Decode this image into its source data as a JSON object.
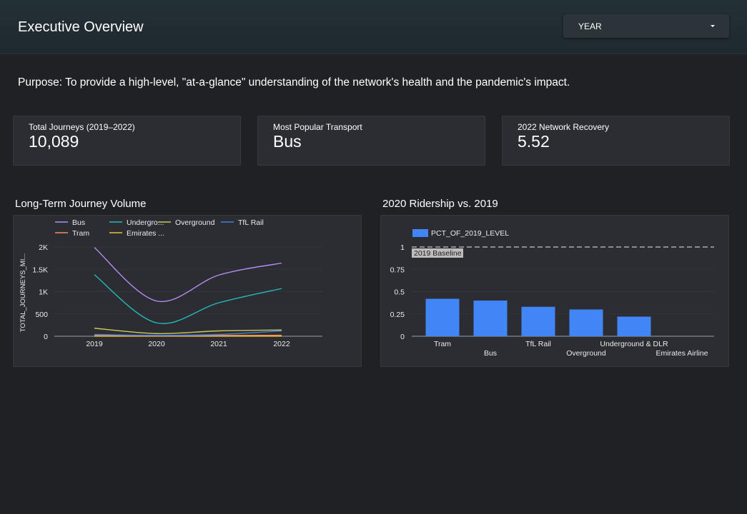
{
  "header": {
    "title": "Executive Overview",
    "year_filter_label": "YEAR"
  },
  "purpose": "Purpose: To provide a high-level, \"at-a-glance\" understanding of the network's health and the pandemic's impact.",
  "kpis": [
    {
      "label": "Total Journeys (2019–2022)",
      "value": "10,089"
    },
    {
      "label": "Most Popular Transport",
      "value": "Bus"
    },
    {
      "label": "2022 Network Recovery",
      "value": "5.52"
    }
  ],
  "charts": {
    "line_title": "Long-Term Journey Volume",
    "bar_title": "2020 Ridership vs. 2019"
  },
  "chart_data": [
    {
      "type": "line",
      "title": "Long-Term Journey Volume",
      "xlabel": "",
      "ylabel": "TOTAL_JOURNEYS_MI...",
      "x": [
        "2019",
        "2020",
        "2021",
        "2022"
      ],
      "ylim": [
        0,
        2000
      ],
      "yticks": [
        {
          "value": 0,
          "label": "0"
        },
        {
          "value": 500,
          "label": "500"
        },
        {
          "value": 1000,
          "label": "1K"
        },
        {
          "value": 1500,
          "label": "1.5K"
        },
        {
          "value": 2000,
          "label": "2K"
        }
      ],
      "legend_position": "top",
      "series": [
        {
          "name": "Bus",
          "legend_label": "Bus",
          "color": "#b48cf2",
          "values": [
            1990,
            790,
            1370,
            1640
          ]
        },
        {
          "name": "Underground & DLR",
          "legend_label": "Undergro...",
          "color": "#27b9b9",
          "values": [
            1380,
            300,
            750,
            1070
          ]
        },
        {
          "name": "Overground",
          "legend_label": "Overground",
          "color": "#c9c95a",
          "values": [
            180,
            60,
            120,
            140
          ]
        },
        {
          "name": "TfL Rail",
          "legend_label": "TfL Rail",
          "color": "#3f7fe0",
          "values": [
            40,
            20,
            40,
            120
          ]
        },
        {
          "name": "Tram",
          "legend_label": "Tram",
          "color": "#f28e5c",
          "values": [
            25,
            10,
            18,
            22
          ]
        },
        {
          "name": "Emirates Airline",
          "legend_label": "Emirates ...",
          "color": "#f2c037",
          "values": [
            2,
            1,
            2,
            2
          ]
        }
      ]
    },
    {
      "type": "bar",
      "title": "2020 Ridership vs. 2019",
      "xlabel": "",
      "ylabel": "",
      "categories": [
        "Tram",
        "Bus",
        "TfL Rail",
        "Overground",
        "Underground & DLR",
        "Emirates Airline"
      ],
      "series": [
        {
          "name": "PCT_OF_2019_LEVEL",
          "color": "#4285f4",
          "values": [
            0.42,
            0.4,
            0.33,
            0.3,
            0.22,
            0
          ]
        }
      ],
      "ylim": [
        0,
        1
      ],
      "yticks": [
        {
          "value": 0,
          "label": "0"
        },
        {
          "value": 0.25,
          "label": "0.25"
        },
        {
          "value": 0.5,
          "label": "0.5"
        },
        {
          "value": 0.75,
          "label": "0.75"
        },
        {
          "value": 1,
          "label": "1"
        }
      ],
      "reference_line": {
        "value": 1,
        "label": "2019 Baseline"
      },
      "legend_position": "top-left"
    }
  ]
}
